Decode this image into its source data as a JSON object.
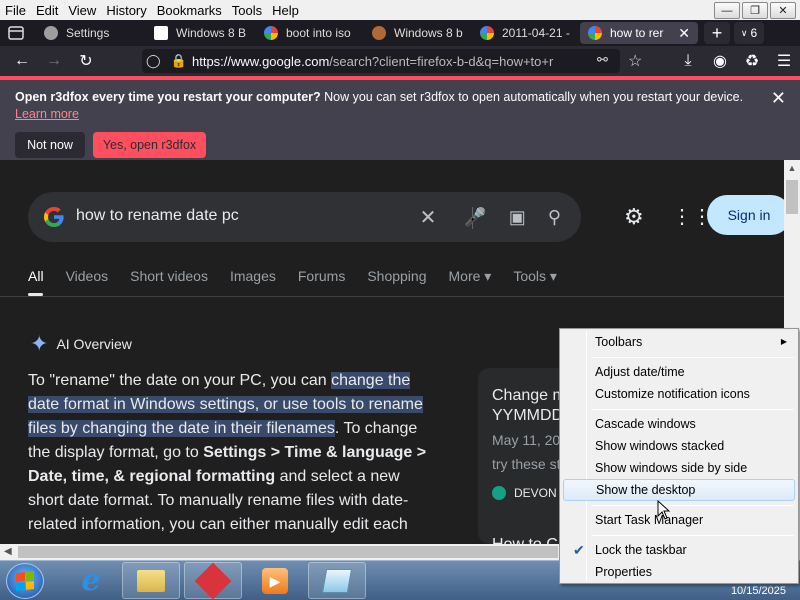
{
  "menubar": {
    "items": [
      "File",
      "Edit",
      "View",
      "History",
      "Bookmarks",
      "Tools",
      "Help"
    ]
  },
  "tabs": [
    {
      "label": "Settings",
      "icon": "gear-icon",
      "color": "#9e9e9e"
    },
    {
      "label": "Windows 8 B",
      "icon": "library-icon",
      "color": "#ffffff"
    },
    {
      "label": "boot into iso",
      "icon": "google-icon",
      "color": "#4285f4"
    },
    {
      "label": "Windows 8 b",
      "icon": "feather-icon",
      "color": "#b06a3a"
    },
    {
      "label": "2011-04-21 -",
      "icon": "google-icon",
      "color": "#4285f4"
    },
    {
      "label": "how to rer",
      "icon": "google-icon",
      "color": "#4285f4",
      "active": true
    }
  ],
  "tabcount": "6",
  "navbar": {
    "url_main": "https://www.google.com",
    "url_rest": "/search?client=firefox-b-d&q=how+to+r"
  },
  "notification": {
    "title": "Open r3dfox every time you restart your computer?",
    "message": " Now you can set r3dfox to open automatically when you restart your device.",
    "link": "Learn more",
    "no_label": "Not now",
    "yes_label": "Yes, open r3dfox"
  },
  "search": {
    "query": "how to rename date pc",
    "signin_label": "Sign in"
  },
  "filters": [
    "All",
    "Videos",
    "Short videos",
    "Images",
    "Forums",
    "Shopping",
    "More ▾",
    "Tools ▾"
  ],
  "ai": {
    "heading": "AI Overview",
    "p1": "To \"rename\" the date on your PC, you can ",
    "hl": "change the date format in Windows settings, or use tools to rename files by changing the date in their filenames",
    "p2": ". To change the display format, go to ",
    "b1": "Settings > Time & language > Date, time, & regional formatting",
    "p3": " and select a new short date format. To manually rename files with date-related information, you can either manually edit each"
  },
  "card": {
    "title1": "Change m",
    "title2": "YYMMDD",
    "date": "May 11, 20",
    "snippet": "try these st",
    "source": "DEVON",
    "next": "How to C"
  },
  "context_menu": {
    "toolbars": "Toolbars",
    "adjust": "Adjust date/time",
    "customize": "Customize notification icons",
    "cascade": "Cascade windows",
    "stacked": "Show windows stacked",
    "side": "Show windows side by side",
    "desktop": "Show the desktop",
    "taskmgr": "Start Task Manager",
    "lock": "Lock the taskbar",
    "properties": "Properties"
  },
  "clock": {
    "date": "10/15/2025"
  },
  "colors": {
    "accent": "#ff4f5e",
    "signin_bg": "#c2e7ff",
    "taskbar": "#4a6b93"
  }
}
